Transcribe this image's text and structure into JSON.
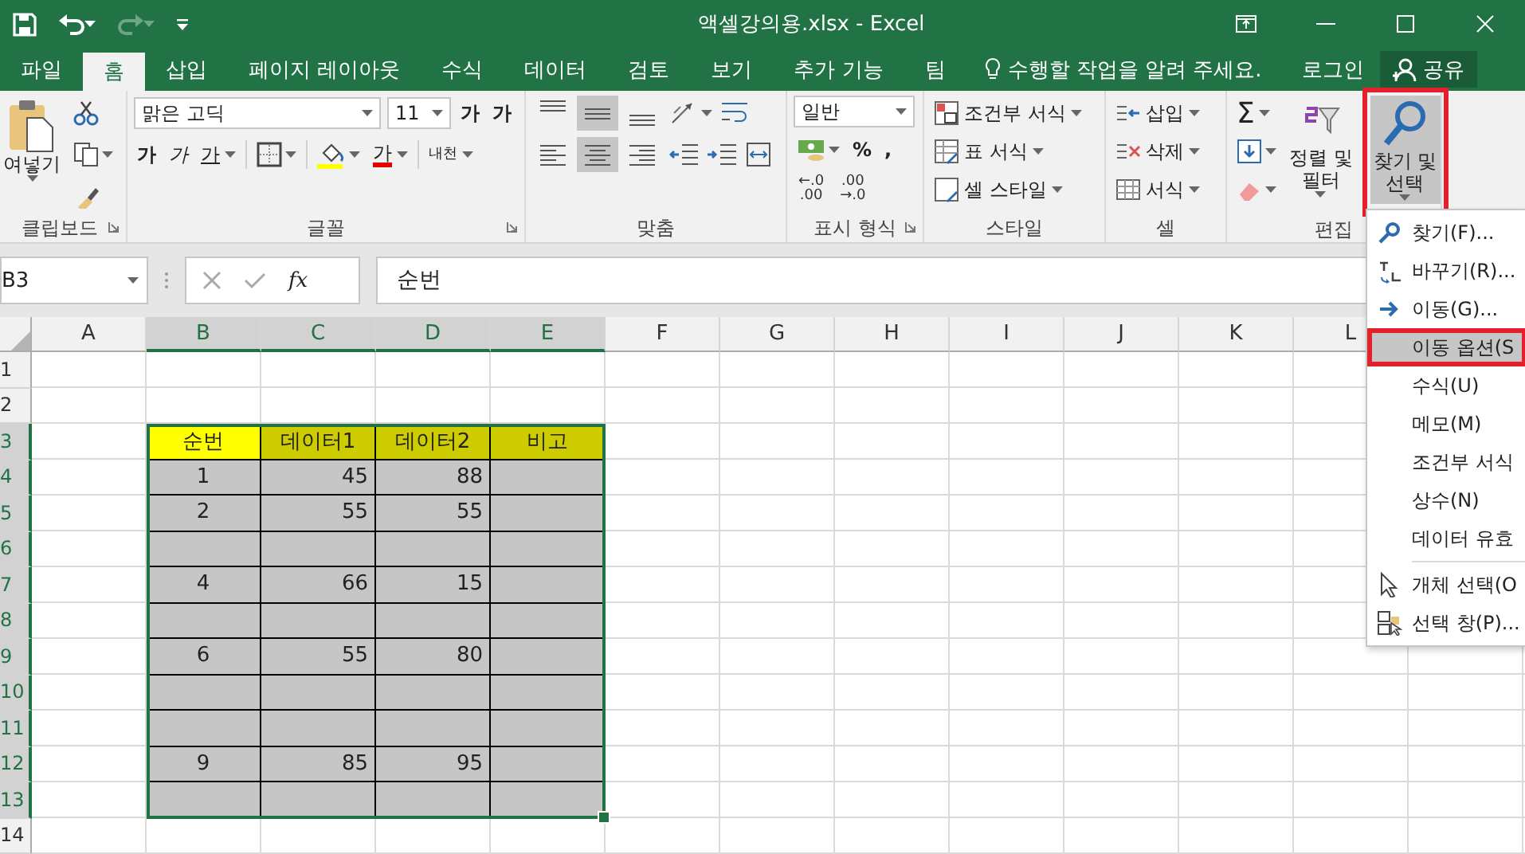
{
  "window": {
    "title": "액셀강의용.xlsx - Excel"
  },
  "tabs": [
    {
      "label": "파일",
      "selected": false
    },
    {
      "label": "홈",
      "selected": true
    },
    {
      "label": "삽입",
      "selected": false
    },
    {
      "label": "페이지 레이아웃",
      "selected": false
    },
    {
      "label": "수식",
      "selected": false
    },
    {
      "label": "데이터",
      "selected": false
    },
    {
      "label": "검토",
      "selected": false
    },
    {
      "label": "보기",
      "selected": false
    },
    {
      "label": "추가 기능",
      "selected": false
    },
    {
      "label": "팀",
      "selected": false
    }
  ],
  "tell_me": {
    "placeholder": "수행할 작업을 알려 주세요."
  },
  "account": {
    "sign_in": "로그인",
    "share": "공유"
  },
  "ribbon": {
    "clipboard": {
      "label": "클립보드",
      "paste": "여넣기",
      "launcher": true
    },
    "font": {
      "label": "글꼴",
      "name": "맑은 고딕",
      "size": "11",
      "grow": "가",
      "shrink": "가",
      "bold": "가",
      "italic": "가",
      "underline": "가",
      "font_color": "가",
      "phonetic": "내천",
      "launcher": true
    },
    "alignment": {
      "label": "맞춤",
      "vertical": [
        {
          "selected": false
        },
        {
          "selected": true
        },
        {
          "selected": false
        }
      ],
      "horizontal": [
        {
          "selected": false
        },
        {
          "selected": true
        },
        {
          "selected": false
        }
      ]
    },
    "number": {
      "label": "표시 형식",
      "format": "일반",
      "percent": "%",
      "comma": ",",
      "increase_decimal": [
        "←.0",
        ".00"
      ],
      "decrease_decimal": [
        ".00",
        "→.0"
      ],
      "launcher": true
    },
    "styles": {
      "label": "스타일",
      "items": [
        "조건부 서식",
        "표 서식",
        "셀 스타일"
      ]
    },
    "cells": {
      "label": "셀",
      "items": [
        "삽입",
        "삭제",
        "서식"
      ]
    },
    "editing": {
      "label": "편집",
      "sum": "Σ",
      "sort_filter": [
        "정렬 및",
        "필터"
      ],
      "find_select": {
        "lines": [
          "찾기 및",
          "선택"
        ],
        "pressed": true,
        "annotated": true
      }
    }
  },
  "formula_bar": {
    "name_box": "B3",
    "function_button": "fx",
    "value": "순번"
  },
  "sheet": {
    "columns": [
      {
        "label": "A",
        "selected": false
      },
      {
        "label": "B",
        "selected": true
      },
      {
        "label": "C",
        "selected": true
      },
      {
        "label": "D",
        "selected": true
      },
      {
        "label": "E",
        "selected": true
      },
      {
        "label": "F",
        "selected": false
      },
      {
        "label": "G",
        "selected": false
      },
      {
        "label": "H",
        "selected": false
      },
      {
        "label": "I",
        "selected": false
      },
      {
        "label": "J",
        "selected": false
      },
      {
        "label": "K",
        "selected": false
      },
      {
        "label": "L",
        "selected": false
      }
    ],
    "rows": [
      {
        "label": "1",
        "selected": false
      },
      {
        "label": "2",
        "selected": false
      },
      {
        "label": "3",
        "selected": true
      },
      {
        "label": "4",
        "selected": true
      },
      {
        "label": "5",
        "selected": true
      },
      {
        "label": "6",
        "selected": true
      },
      {
        "label": "7",
        "selected": true
      },
      {
        "label": "8",
        "selected": true
      },
      {
        "label": "9",
        "selected": true
      },
      {
        "label": "10",
        "selected": true
      },
      {
        "label": "11",
        "selected": true
      },
      {
        "label": "12",
        "selected": true
      },
      {
        "label": "13",
        "selected": true
      },
      {
        "label": "14",
        "selected": false
      }
    ],
    "table": {
      "header": [
        "순번",
        "데이터1",
        "데이터2",
        "비고"
      ],
      "rows": [
        [
          "1",
          "45",
          "88"
        ],
        [
          "2",
          "55",
          "55"
        ],
        null,
        [
          "4",
          "66",
          "15"
        ],
        null,
        [
          "6",
          "55",
          "80"
        ],
        null,
        null,
        [
          "9",
          "85",
          "95"
        ],
        null
      ]
    }
  },
  "menu": {
    "items": [
      {
        "label": "찾기(F)...",
        "selected": false,
        "annotated": false,
        "divider_before": false
      },
      {
        "label": "바꾸기(R)...",
        "selected": false,
        "annotated": false,
        "divider_before": false
      },
      {
        "label": "이동(G)...",
        "selected": false,
        "annotated": false,
        "divider_before": false
      },
      {
        "label": "이동 옵션(S",
        "selected": true,
        "annotated": true,
        "divider_before": false
      },
      {
        "label": "수식(U)",
        "selected": false,
        "annotated": false,
        "divider_before": false
      },
      {
        "label": "메모(M)",
        "selected": false,
        "annotated": false,
        "divider_before": false
      },
      {
        "label": "조건부 서식",
        "selected": false,
        "annotated": false,
        "divider_before": false
      },
      {
        "label": "상수(N)",
        "selected": false,
        "annotated": false,
        "divider_before": false
      },
      {
        "label": "데이터 유효",
        "selected": false,
        "annotated": false,
        "divider_before": false
      },
      {
        "label": "개체 선택(O",
        "selected": false,
        "annotated": false,
        "divider_before": true
      },
      {
        "label": "선택 창(P)...",
        "selected": false,
        "annotated": false,
        "divider_before": false
      }
    ]
  }
}
